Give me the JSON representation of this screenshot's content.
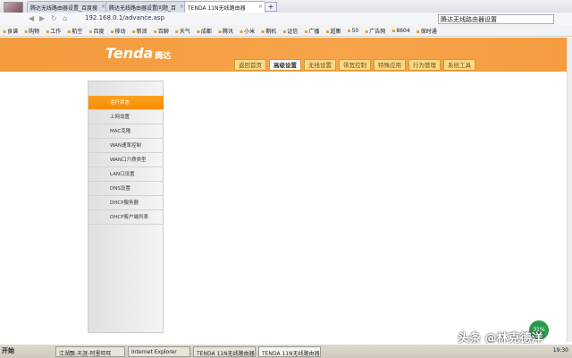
{
  "browser": {
    "tabs": [
      {
        "label": "腾达无线路由器设置_百度搜"
      },
      {
        "label": "腾达无线路由器设置问题_百"
      },
      {
        "label": "TENDA 11N无线路由器"
      }
    ],
    "new_tab": "+",
    "url": "192.168.0.1/advance.asp",
    "search_value": "腾达无线路由器设置",
    "bookmarks": [
      "食谱",
      "购物",
      "工作",
      "航空",
      "百度",
      "移动",
      "新浪",
      "百聊",
      "天气",
      "成都",
      "腾讯",
      "小米",
      "期机",
      "证信",
      "广播",
      "超集",
      "50",
      "广告网",
      "8604",
      "保时通"
    ]
  },
  "header": {
    "logo": "Tenda",
    "logo_cn": "腾达",
    "menu": [
      {
        "label": "返回首页"
      },
      {
        "label": "高级设置",
        "active": true
      },
      {
        "label": "无线设置"
      },
      {
        "label": "带宽控制"
      },
      {
        "label": "特殊应用"
      },
      {
        "label": "行为管理"
      },
      {
        "label": "系统工具"
      }
    ]
  },
  "sidebar": {
    "items": [
      {
        "label": "运行状态",
        "active": true
      },
      {
        "label": "上网设置"
      },
      {
        "label": "MAC克隆"
      },
      {
        "label": "WAN速率控制"
      },
      {
        "label": "WAN口介质类型"
      },
      {
        "label": "LAN口设置"
      },
      {
        "label": "DNS设置"
      },
      {
        "label": "DHCP服务器"
      },
      {
        "label": "DHCP客户端列表"
      }
    ]
  },
  "taskbar": {
    "start": "开始",
    "items": [
      {
        "label": "江湖飘-天涯-阿里旺旺"
      },
      {
        "label": "Internet Explorer"
      },
      {
        "label": "TENDA 11N无线路由器"
      },
      {
        "label": "TENDA 11N无线路由器",
        "active": true
      }
    ],
    "clock": "19:30",
    "net_badge": "31%"
  },
  "watermark": "头条 @林克德洋",
  "colors": {
    "accent": "#f7a044",
    "active_item": "#f78c00"
  }
}
